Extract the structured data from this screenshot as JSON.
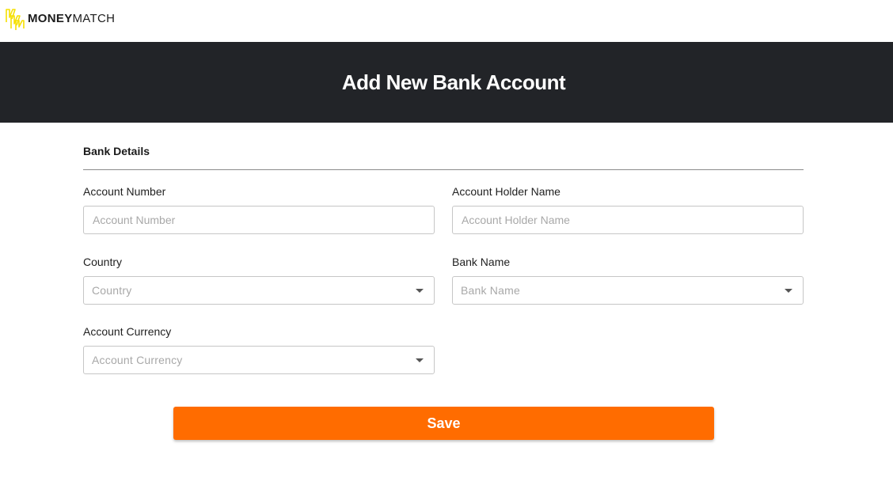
{
  "brand": {
    "icon": "moneymatch-logo-icon",
    "name_bold": "MONEY",
    "name_light": "MATCH",
    "accent_color": "#f5e000"
  },
  "header": {
    "title": "Add New Bank Account",
    "background": "#222428"
  },
  "form": {
    "section_title": "Bank Details",
    "fields": {
      "account_number": {
        "label": "Account Number",
        "placeholder": "Account Number",
        "value": ""
      },
      "account_holder_name": {
        "label": "Account Holder Name",
        "placeholder": "Account Holder Name",
        "value": ""
      },
      "country": {
        "label": "Country",
        "placeholder": "Country",
        "icon": "chevron-down-icon"
      },
      "bank_name": {
        "label": "Bank Name",
        "placeholder": "Bank Name",
        "icon": "chevron-down-icon"
      },
      "account_currency": {
        "label": "Account Currency",
        "placeholder": "Account Currency",
        "icon": "chevron-down-icon"
      }
    },
    "save_label": "Save",
    "save_color": "#ff6c00"
  }
}
